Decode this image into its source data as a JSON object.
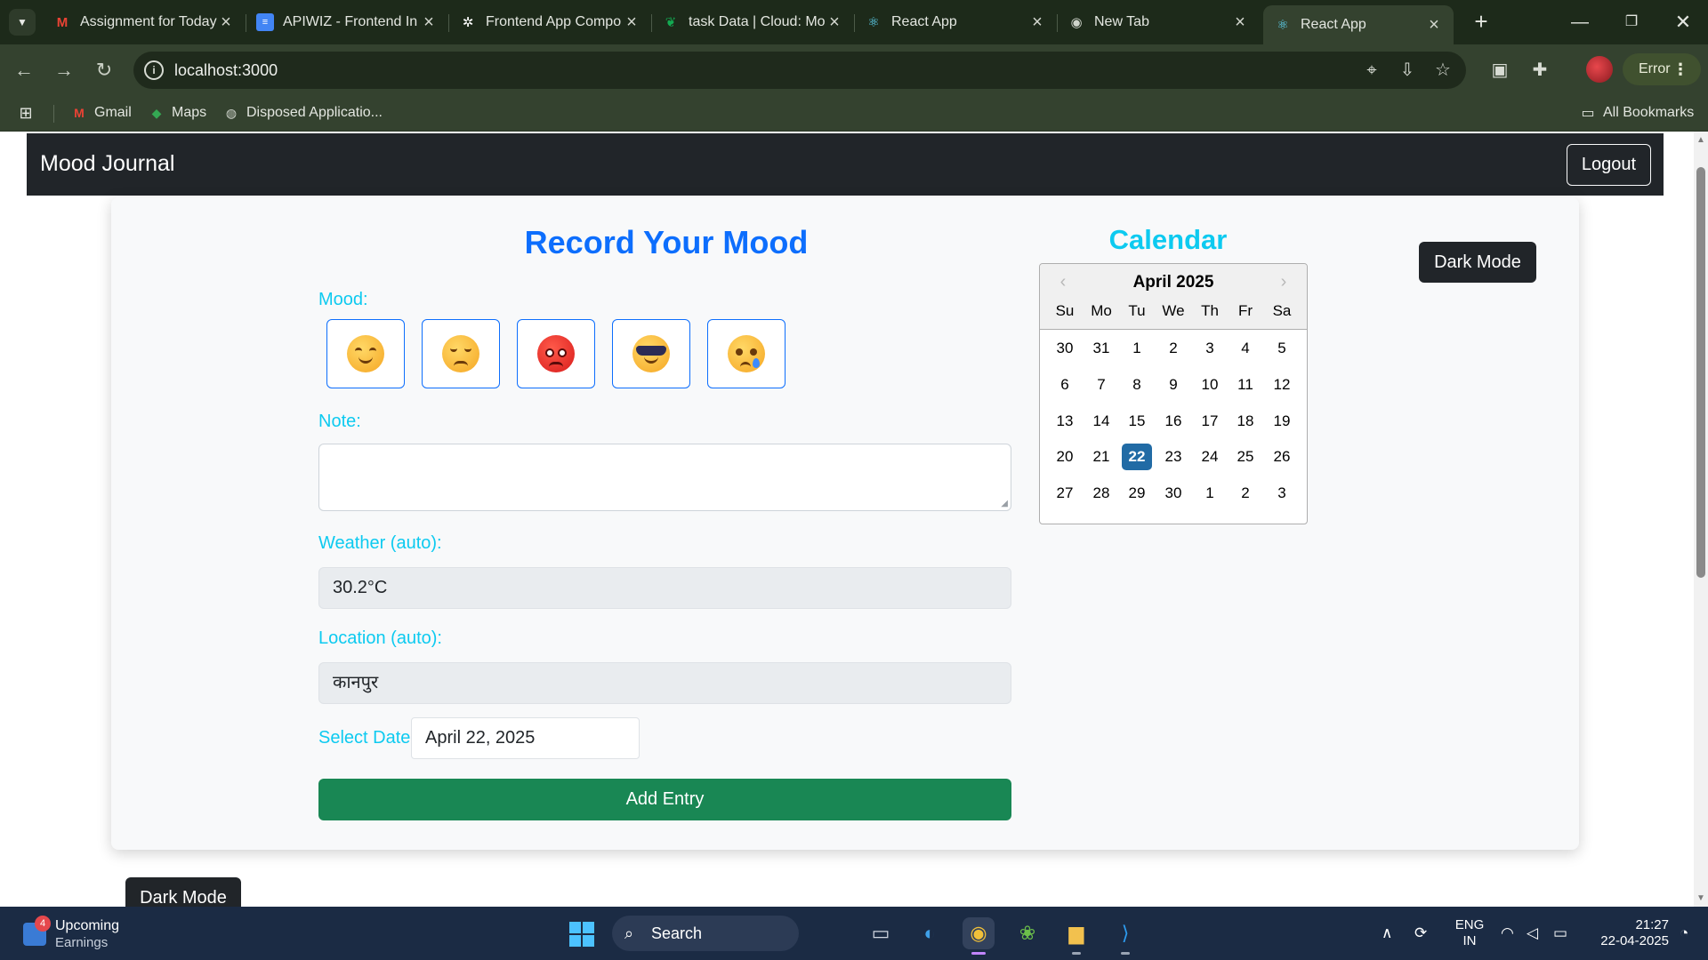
{
  "browser": {
    "tabs": [
      {
        "title": "Assignment for Today",
        "favicon": "gmail-icon",
        "active": false
      },
      {
        "title": "APIWIZ - Frontend In",
        "favicon": "docs-icon",
        "active": false
      },
      {
        "title": "Frontend App Compo",
        "favicon": "openai-icon",
        "active": false
      },
      {
        "title": "task Data | Cloud: Mo",
        "favicon": "mongodb-icon",
        "active": false
      },
      {
        "title": "React App",
        "favicon": "react-icon",
        "active": false
      },
      {
        "title": "New Tab",
        "favicon": "chrome-icon",
        "active": false
      },
      {
        "title": "React App",
        "favicon": "react-icon",
        "active": true
      }
    ],
    "url": "localhost:3000",
    "profile_status": "Error",
    "bookmarks": [
      {
        "label": "Gmail",
        "icon": "gmail-icon"
      },
      {
        "label": "Maps",
        "icon": "maps-icon"
      },
      {
        "label": "Disposed Applicatio...",
        "icon": "globe-icon"
      }
    ],
    "all_bookmarks_label": "All Bookmarks"
  },
  "navbar": {
    "brand": "Mood Journal",
    "logout_label": "Logout"
  },
  "form": {
    "title": "Record Your Mood",
    "mood_label": "Mood:",
    "moods": [
      "smiling-face-icon",
      "pensive-face-icon",
      "angry-face-icon",
      "sunglasses-face-icon",
      "crying-face-icon"
    ],
    "note_label": "Note:",
    "note_value": "",
    "weather_label": "Weather (auto):",
    "weather_value": "30.2°C",
    "location_label": "Location (auto):",
    "location_value": "कानपुर",
    "date_label": "Select Date:",
    "date_value": "April 22, 2025",
    "submit_label": "Add Entry"
  },
  "calendar": {
    "title": "Calendar",
    "month": "April 2025",
    "weekdays": [
      "Su",
      "Mo",
      "Tu",
      "We",
      "Th",
      "Fr",
      "Sa"
    ],
    "weeks": [
      [
        "30",
        "31",
        "1",
        "2",
        "3",
        "4",
        "5"
      ],
      [
        "6",
        "7",
        "8",
        "9",
        "10",
        "11",
        "12"
      ],
      [
        "13",
        "14",
        "15",
        "16",
        "17",
        "18",
        "19"
      ],
      [
        "20",
        "21",
        "22",
        "23",
        "24",
        "25",
        "26"
      ],
      [
        "27",
        "28",
        "29",
        "30",
        "1",
        "2",
        "3"
      ]
    ],
    "selected_day": "22"
  },
  "dark_mode_label": "Dark Mode",
  "taskbar": {
    "widget_badge": "4",
    "widget_title": "Upcoming",
    "widget_subtitle": "Earnings",
    "search_placeholder": "Search",
    "language": "ENG",
    "region": "IN",
    "time": "21:27",
    "date": "22-04-2025"
  },
  "colors": {
    "primary": "#0d6efd",
    "info": "#0dcaf0",
    "success": "#198754",
    "dark": "#212529",
    "calendar_selected": "#216ba5"
  }
}
